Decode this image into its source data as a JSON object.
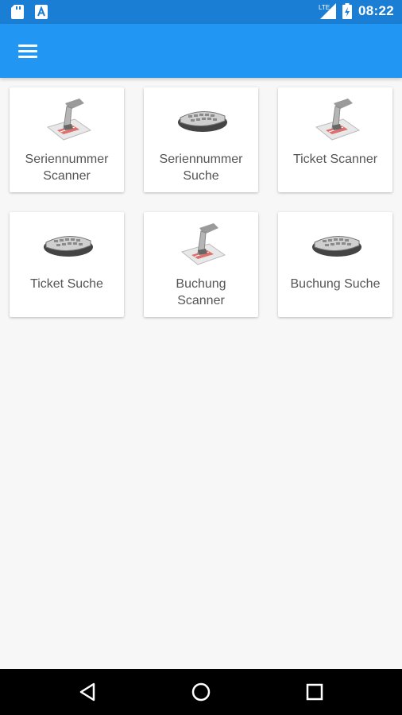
{
  "status_bar": {
    "time": "08:22",
    "network": "LTE",
    "icons": [
      "sd-card-icon",
      "a-notification-icon",
      "signal-icon",
      "battery-icon"
    ]
  },
  "app_bar": {
    "menu_icon": "menu-icon"
  },
  "tiles": [
    {
      "line1": "Seriennummer",
      "line2": "Scanner",
      "icon": "hand-scanner-icon"
    },
    {
      "line1": "Seriennummer",
      "line2": "Suche",
      "icon": "keyboard-icon"
    },
    {
      "line1": "Ticket Scanner",
      "line2": "",
      "icon": "hand-scanner-icon"
    },
    {
      "line1": "Ticket Suche",
      "line2": "",
      "icon": "keyboard-icon"
    },
    {
      "line1": "Buchung",
      "line2": "Scanner",
      "icon": "hand-scanner-icon"
    },
    {
      "line1": "Buchung Suche",
      "line2": "",
      "icon": "keyboard-icon"
    }
  ],
  "nav_bar": {
    "icons": [
      "back-icon",
      "home-icon",
      "recents-icon"
    ]
  },
  "colors": {
    "status_bar": "#1a7fd4",
    "app_bar": "#2196f3",
    "background": "#f7f7f7",
    "tile": "#ffffff",
    "tile_text": "#555555"
  }
}
